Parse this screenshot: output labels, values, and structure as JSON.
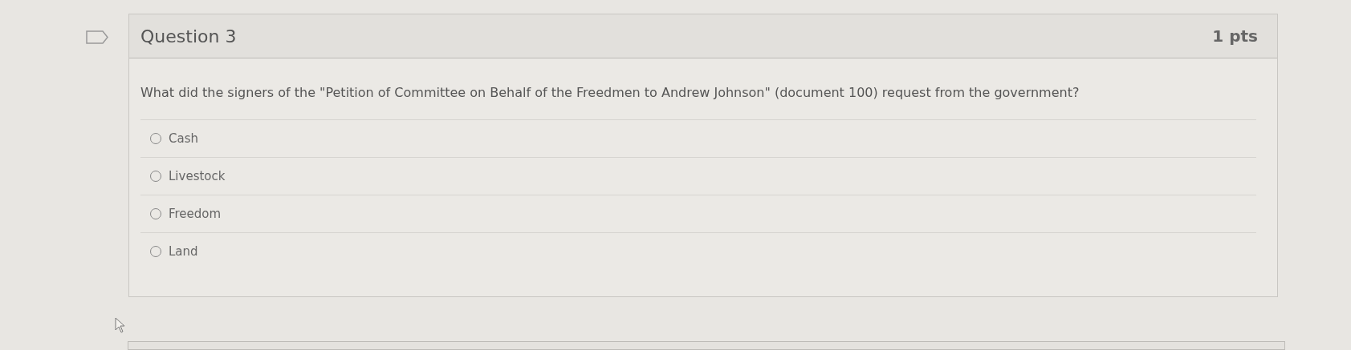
{
  "question": {
    "title": "Question 3",
    "points": "1 pts",
    "bookmarked": false,
    "text": "What did the signers of the \"Petition of Committee on Behalf of the Freedmen to Andrew Johnson\" (document 100) request from the government?",
    "answers": [
      {
        "label": "Cash",
        "selected": false
      },
      {
        "label": "Livestock",
        "selected": false
      },
      {
        "label": "Freedom",
        "selected": false
      },
      {
        "label": "Land",
        "selected": false
      }
    ]
  }
}
